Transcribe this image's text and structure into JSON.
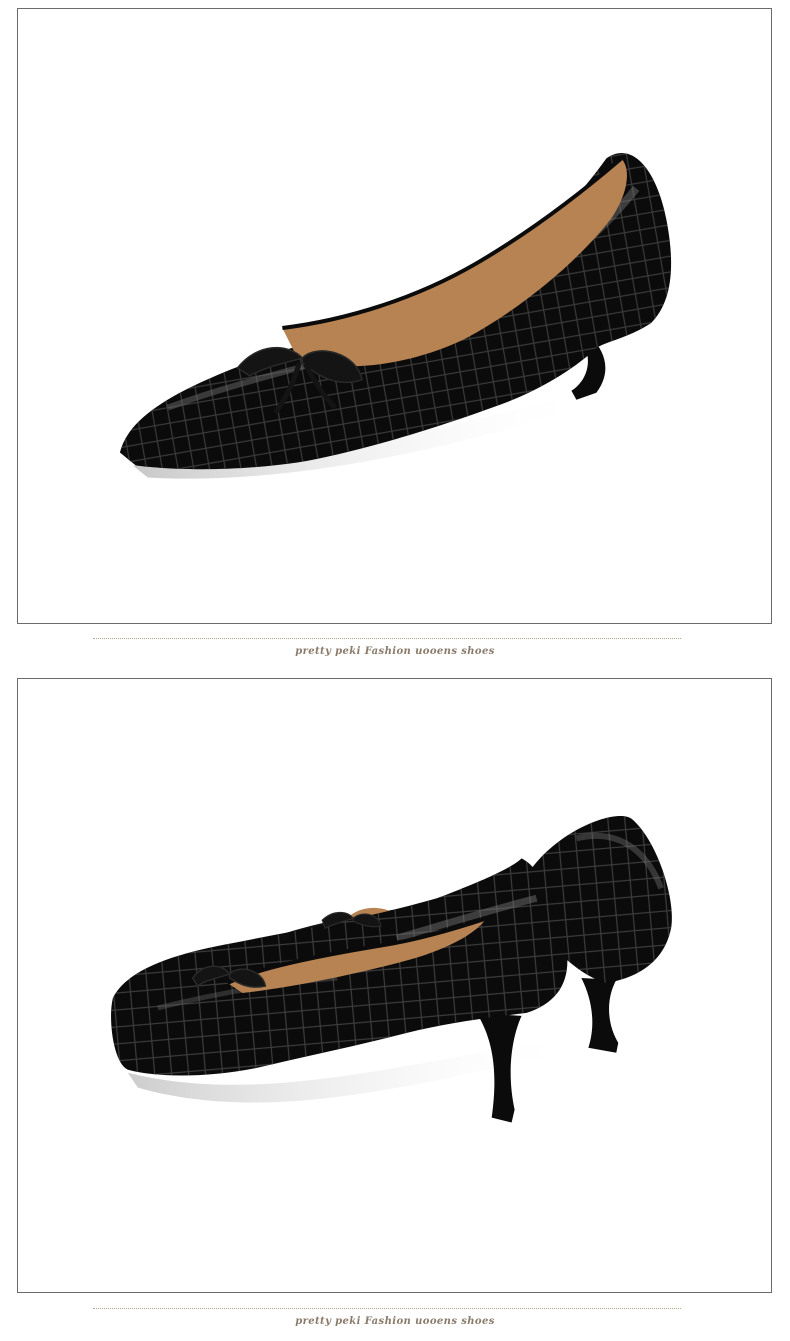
{
  "panels": [
    {
      "caption": "pretty peki Fashion uooens shoes"
    },
    {
      "caption": "pretty peki Fashion uooens shoes"
    }
  ],
  "colors": {
    "leather": "#0b0b0b",
    "lining": "#b78352",
    "border": "#6b6b6b",
    "caption": "#8a7a6a"
  }
}
